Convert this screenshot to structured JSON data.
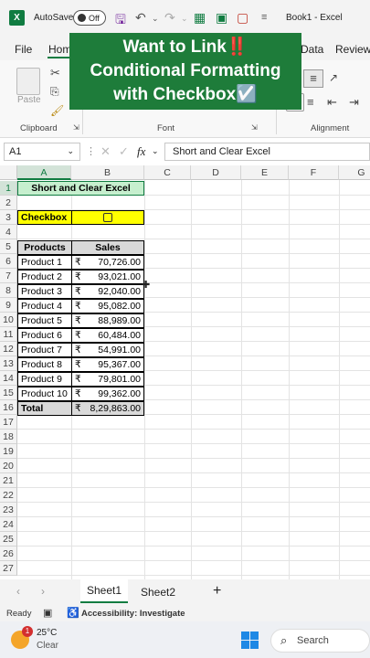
{
  "titlebar": {
    "autosave_label": "AutoSave",
    "autosave_state": "Off",
    "book_title": "Book1  -  Excel"
  },
  "ribbon_tabs": [
    "File",
    "Home",
    "Data",
    "Review"
  ],
  "ribbon_groups": {
    "clipboard": "Clipboard",
    "paste": "Paste",
    "font": "Font",
    "alignment": "Alignment"
  },
  "banner": {
    "line1": "Want to Link‼️",
    "line2": "Conditional Formatting",
    "line3": "with Checkbox☑️"
  },
  "formula_bar": {
    "name_box": "A1",
    "fx": "fx",
    "content": "Short and Clear Excel"
  },
  "columns": [
    "A",
    "B",
    "C",
    "D",
    "E",
    "F",
    "G"
  ],
  "rows": [
    "1",
    "2",
    "3",
    "4",
    "5",
    "6",
    "7",
    "8",
    "9",
    "10",
    "11",
    "12",
    "13",
    "14",
    "15",
    "16",
    "17",
    "18",
    "19",
    "20",
    "21",
    "22",
    "23",
    "24",
    "25",
    "26",
    "27"
  ],
  "sheet": {
    "title": "Short and Clear Excel",
    "checkbox_label": "Checkbox",
    "header_products": "Products",
    "header_sales": "Sales",
    "currency": "₹",
    "products": [
      {
        "name": "Product 1",
        "sales": "70,726.00"
      },
      {
        "name": "Product 2",
        "sales": "93,021.00"
      },
      {
        "name": "Product 3",
        "sales": "92,040.00"
      },
      {
        "name": "Product 4",
        "sales": "95,082.00"
      },
      {
        "name": "Product 5",
        "sales": "88,989.00"
      },
      {
        "name": "Product 6",
        "sales": "60,484.00"
      },
      {
        "name": "Product 7",
        "sales": "54,991.00"
      },
      {
        "name": "Product 8",
        "sales": "95,367.00"
      },
      {
        "name": "Product 9",
        "sales": "79,801.00"
      },
      {
        "name": "Product 10",
        "sales": "99,362.00"
      }
    ],
    "total_label": "Total",
    "total_value": "8,29,863.00"
  },
  "sheet_tabs": [
    "Sheet1",
    "Sheet2"
  ],
  "status": {
    "ready": "Ready",
    "accessibility": "Accessibility: Investigate"
  },
  "taskbar": {
    "temperature": "25°C",
    "condition": "Clear",
    "badge": "1",
    "search": "Search"
  },
  "colors": {
    "excel_green": "#107c41",
    "banner_green": "#1e7c3a",
    "title_fill": "#c6efce",
    "checkbox_fill": "#ffff00",
    "header_fill": "#d9d9d9"
  }
}
